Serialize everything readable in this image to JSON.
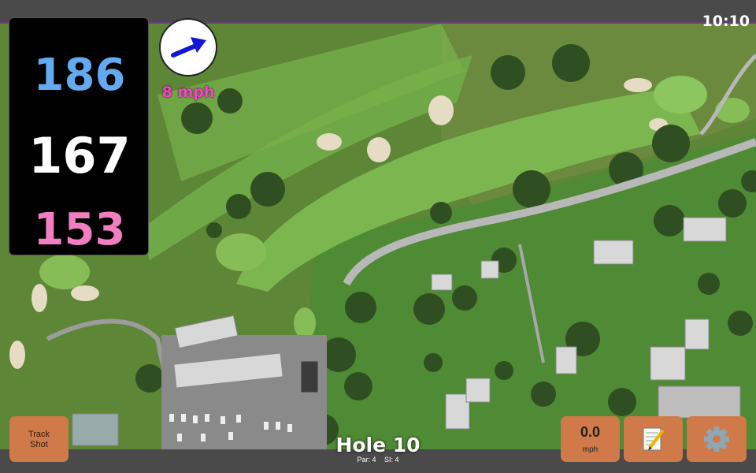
{
  "status_bar": {
    "time": "10:10"
  },
  "distances": {
    "back": "186",
    "center": "167",
    "front": "153"
  },
  "wind": {
    "speed_label": "8 mph",
    "direction_icon": "arrow-icon",
    "arrow_color": "#1515d6"
  },
  "hole": {
    "title": "Hole 10",
    "par": "Par: 4",
    "stroke_index": "SI: 4"
  },
  "buttons": {
    "track_shot_line1": "Track",
    "track_shot_line2": "Shot",
    "speed_value": "0.0",
    "speed_unit": "mph",
    "notes_icon": "notepad-icon",
    "settings_icon": "gear-icon"
  },
  "colors": {
    "back": "#64aaf0",
    "center": "#ffffff",
    "front": "#f27ec2",
    "wind_text": "#ff3fd1",
    "button": "#d07a49"
  }
}
